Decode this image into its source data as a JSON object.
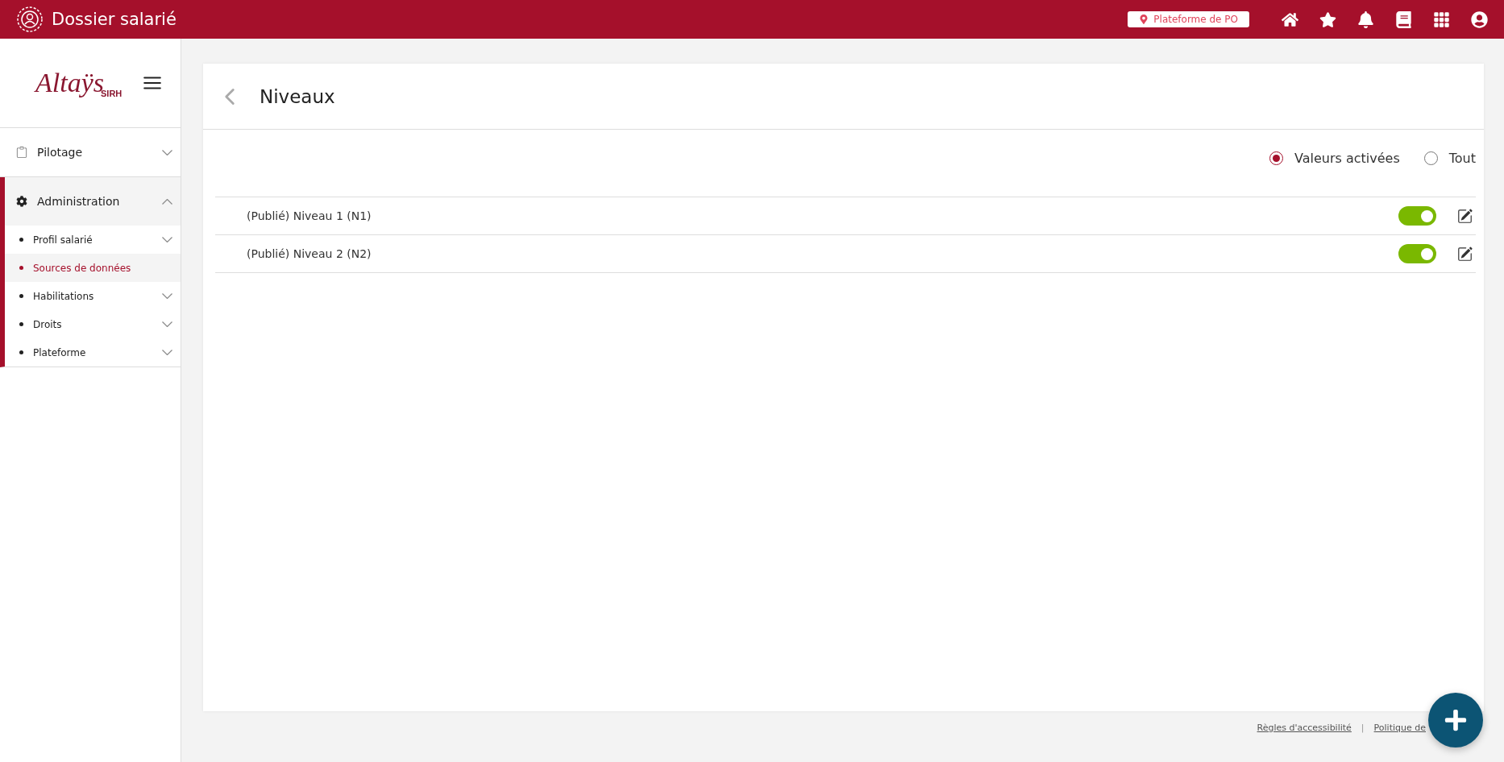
{
  "app_bar": {
    "title": "Dossier salarié",
    "platform": "Plateforme de PO"
  },
  "sidebar": {
    "logo": {
      "name": "Altaÿs",
      "sub": "SIRH"
    },
    "sections": [
      {
        "label": "Pilotage",
        "expanded": false,
        "active": false
      },
      {
        "label": "Administration",
        "expanded": true,
        "active": true,
        "children": [
          {
            "label": "Profil salarié",
            "has_children": true,
            "selected": false
          },
          {
            "label": "Sources de données",
            "has_children": false,
            "selected": true
          },
          {
            "label": "Habilitations",
            "has_children": true,
            "selected": false
          },
          {
            "label": "Droits",
            "has_children": true,
            "selected": false
          },
          {
            "label": "Plateforme",
            "has_children": true,
            "selected": false
          }
        ]
      }
    ]
  },
  "page": {
    "title": "Niveaux",
    "filters": [
      {
        "label": "Valeurs activées",
        "selected": true
      },
      {
        "label": "Tout",
        "selected": false
      }
    ],
    "rows": [
      {
        "label": "(Publié) Niveau 1 (N1)",
        "on": true
      },
      {
        "label": "(Publié) Niveau 2 (N2)",
        "on": true
      }
    ]
  },
  "footer": {
    "links": [
      "Règles d'accessibilité",
      "Politique de"
    ],
    "separator": "|"
  }
}
